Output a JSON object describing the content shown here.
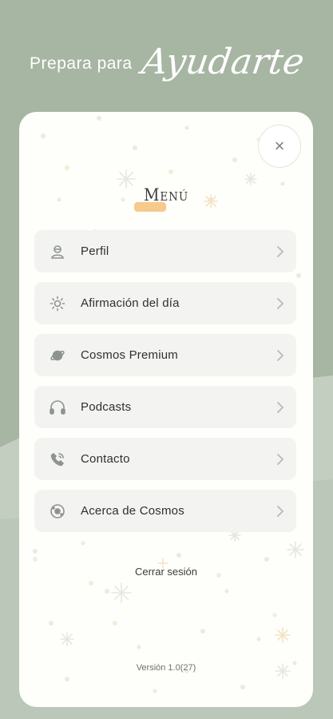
{
  "header": {
    "lead": "Prepara para",
    "script": "Ayudarte"
  },
  "menu": {
    "title": "Menú",
    "close_label": "×",
    "items": [
      {
        "label": "Perfil",
        "icon": "profile-icon"
      },
      {
        "label": "Afirmación del día",
        "icon": "sun-icon"
      },
      {
        "label": "Cosmos Premium",
        "icon": "planet-icon"
      },
      {
        "label": "Podcasts",
        "icon": "headphones-icon"
      },
      {
        "label": "Contacto",
        "icon": "phone-icon"
      },
      {
        "label": "Acerca de Cosmos",
        "icon": "cosmos-icon"
      }
    ],
    "logout_label": "Cerrar sesión",
    "version": "Versión 1.0(27)"
  },
  "colors": {
    "background": "#a7b5a3",
    "card": "#fefefb",
    "item_bg": "#f3f4f1",
    "highlight": "#f6c98d",
    "icon": "#8e948d"
  }
}
